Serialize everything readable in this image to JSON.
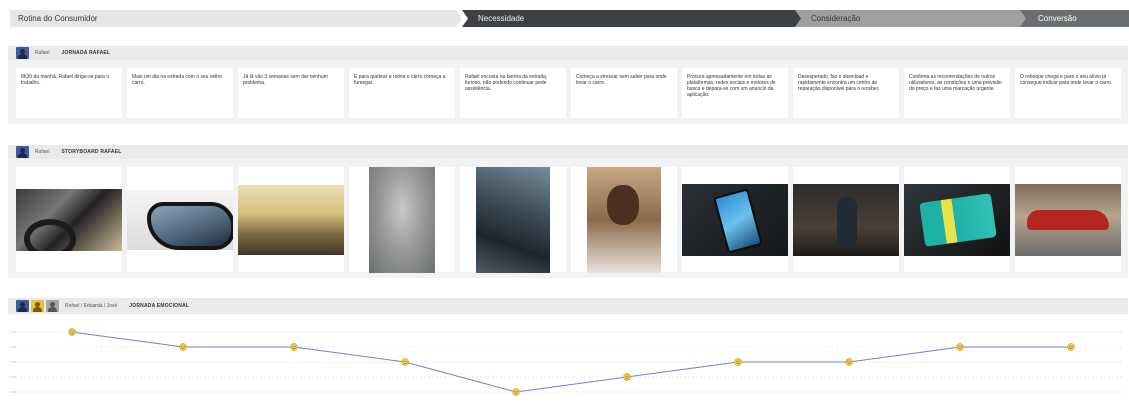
{
  "phases": {
    "start": "Rotina do Consumidor",
    "need": "Necessidade",
    "consideration": "Consideração",
    "conversion": "Conversão"
  },
  "journey": {
    "persona": "Rafael",
    "title": "JORNADA RAFAEL",
    "steps": [
      "8h30 da manhã, Rafael dirige-se para o trabalho.",
      "Mais um dia na estrada com o seu velho carro.",
      "Já lá vão 3 semanas sem dar nenhum problema.",
      "E para quebrar a rotina o carro começa a fumegar.",
      "Rafael encosta na berma da estrada, furioso, não podendo continuar pede assistência.",
      "Começa a stressar sem saber para onde levar o carro.",
      "Procura apressadamente em todas as plataformas, redes sociais e motores de busca e depara-se com um anuncio da aplicação.",
      "Desesperado, faz o download e rapidamente encontra um centro de reparação disponível para o receber.",
      "Confirma as recomendações de outros utilizadores, as condições e uma previsão do preço e faz uma marcação urgente.",
      "O reboque chega e para o seu alívio já consegue indicar para onde levar o carro."
    ]
  },
  "storyboard": {
    "persona": "Rafael",
    "title": "STORYBOARD RAFAEL",
    "photos": [
      "car-interior",
      "side-mirror",
      "sunrise-street",
      "smoke",
      "engine",
      "stressed-man",
      "smartphone",
      "mechanic-garage",
      "app-on-phone",
      "car-on-tow-truck"
    ]
  },
  "emotional": {
    "personas": "Rafael / Eduarda / José",
    "title": "JORNADA EMOCIONAL",
    "levels": [
      4,
      3,
      3,
      2,
      0,
      1,
      2,
      2,
      3,
      3
    ],
    "line_color": "#6f7ed8",
    "dot_color": "#f2c94c"
  }
}
